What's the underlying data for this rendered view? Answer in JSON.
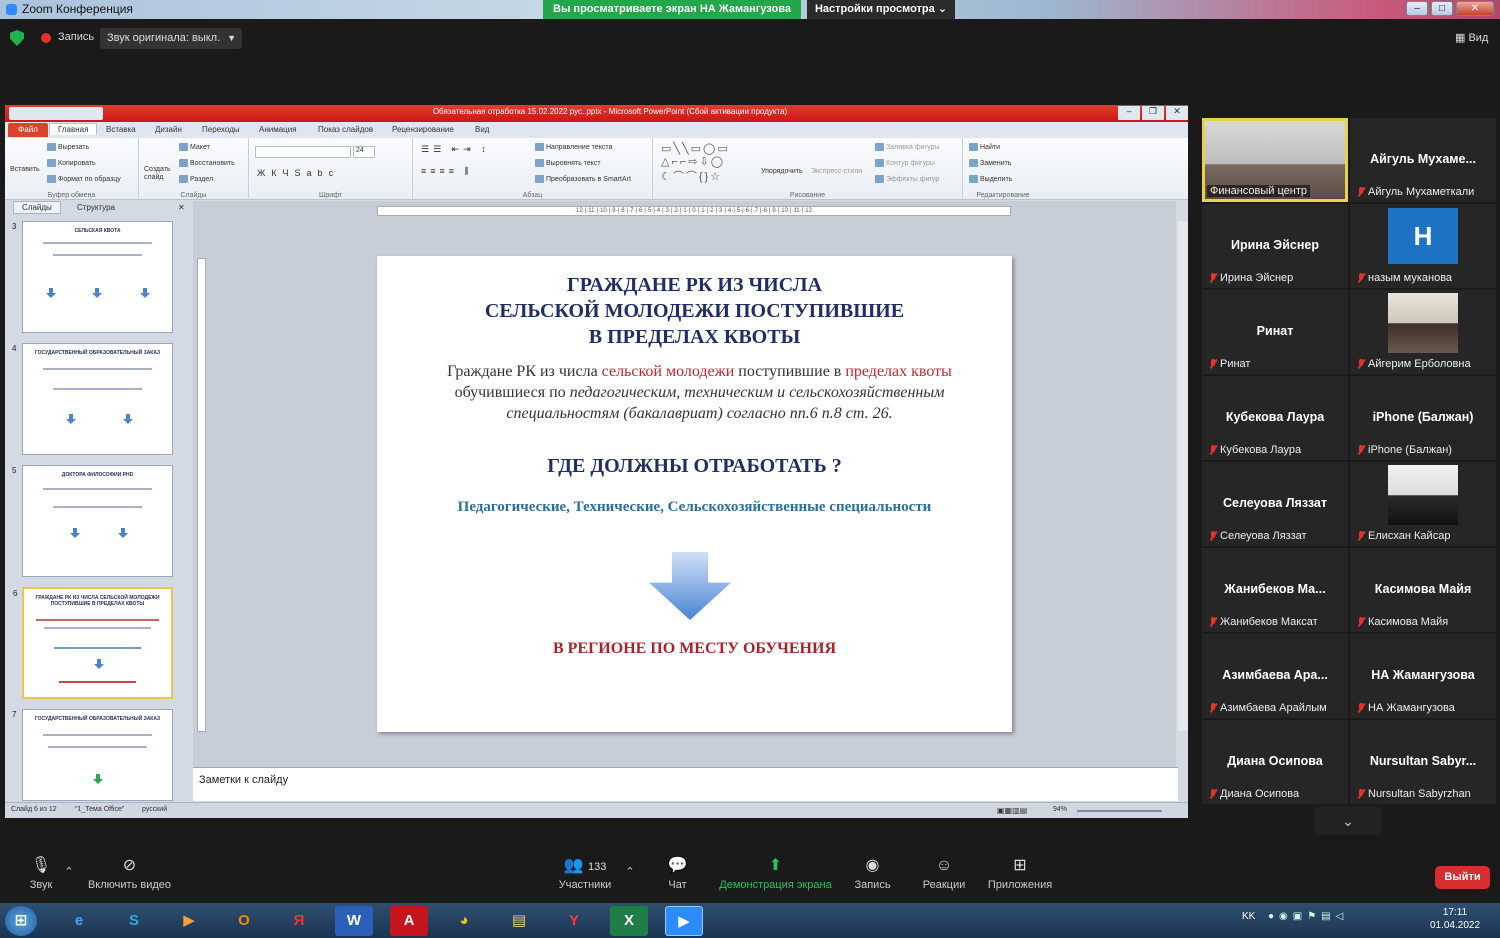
{
  "window": {
    "title": "Zoom Конференция"
  },
  "banner": {
    "viewing": "Вы просматриваете экран НА Жамангузова",
    "view_settings": "Настройки просмотра"
  },
  "topbar": {
    "record": "Запись",
    "original_sound": "Звук оригинала: выкл.",
    "view": "Вид"
  },
  "ppt": {
    "title": "Обязательная отработка 15.02.2022 рус..pptx - Microsoft PowerPoint (Сбой активации продукта)",
    "tabs": [
      "Файл",
      "Главная",
      "Вставка",
      "Дизайн",
      "Переходы",
      "Анимация",
      "Показ слайдов",
      "Рецензирование",
      "Вид"
    ],
    "ribbon": {
      "clipboard": {
        "paste": "Вставить",
        "cut": "Вырезать",
        "copy": "Копировать",
        "format": "Формат по образцу",
        "label": "Буфер обмена"
      },
      "slides": {
        "new": "Создать слайд",
        "layout": "Макет",
        "reset": "Восстановить",
        "section": "Раздел",
        "label": "Слайды"
      },
      "font": {
        "label": "Шрифт",
        "size": "24"
      },
      "paragraph": {
        "dir": "Направление текста",
        "align": "Выровнять текст",
        "smartart": "Преобразовать в SmartArt",
        "label": "Абзац"
      },
      "drawing": {
        "arrange": "Упорядочить",
        "styles": "Экспресс-стили",
        "fill": "Заливка фигуры",
        "outline": "Контур фигуры",
        "effects": "Эффекты фигур",
        "label": "Рисование"
      },
      "editing": {
        "find": "Найти",
        "replace": "Заменить",
        "select": "Выделить",
        "label": "Редактирование"
      }
    },
    "panel_tabs": [
      "Слайды",
      "Структура"
    ],
    "thumbs": [
      {
        "num": "3",
        "title": "СЕЛЬСКАЯ КВОТА"
      },
      {
        "num": "4",
        "title": "ГОСУДАРСТВЕННЫЙ ОБРАЗОВАТЕЛЬНЫЙ ЗАКАЗ"
      },
      {
        "num": "5",
        "title": "ДОКТОРА ФИЛОСОФИИ PHD"
      },
      {
        "num": "6",
        "title": "ГРАЖДАНЕ РК ИЗ ЧИСЛА СЕЛЬСКОЙ МОЛОДЕЖИ ПОСТУПИВШИЕ В ПРЕДЕЛАХ КВОТЫ"
      },
      {
        "num": "7",
        "title": "ГОСУДАРСТВЕННЫЙ ОБРАЗОВАТЕЛЬНЫЙ ЗАКАЗ"
      }
    ],
    "ruler": "·12·|·11·|·10·|·9·|·8·|·7·|·6·|·5·|·4·|·3·|·2·|·1·|·0·|·1·|·2·|·3·|·4·|·5·|·6·|·7·|·8·|·9·|·10·|·11·|·12·",
    "slide": {
      "heading_l1": "ГРАЖДАНЕ РК ИЗ ЧИСЛА",
      "heading_l2": "СЕЛЬСКОЙ МОЛОДЕЖИ ПОСТУПИВШИЕ",
      "heading_l3": "В ПРЕДЕЛАХ КВОТЫ",
      "body_1": "Граждане РК из числа ",
      "body_red1": "сельской молодежи",
      "body_2": " поступившие в ",
      "body_red2": "пределах квоты",
      "body_3": " обучившиеся по ",
      "body_it": "педагогическим, техническим и сельскохозяйственным специальностям (бакалавриат) согласно пп.6 п.8 ст. 26.",
      "question": "ГДЕ ДОЛЖНЫ ОТРАБОТАТЬ ?",
      "specs": "Педагогические, Технические, Сельскохозяйственные специальности",
      "answer": "В РЕГИОНЕ ПО МЕСТУ ОБУЧЕНИЯ"
    },
    "notes": "Заметки к слайду",
    "status": {
      "slide": "Слайд 6 из 12",
      "theme": "\"1_Тема Office\"",
      "lang": "русский",
      "zoom": "94%"
    }
  },
  "participants": [
    {
      "name": "",
      "label": "Финансовый центр",
      "type": "photo"
    },
    {
      "name": "Айгуль Мухаме...",
      "label": "Айгуль Мухаметкали",
      "type": "name"
    },
    {
      "name": "Ирина Эйснер",
      "label": "Ирина Эйснер",
      "type": "name"
    },
    {
      "name": "H",
      "label": "назым муканова",
      "type": "avatar"
    },
    {
      "name": "Ринат",
      "label": "Ринат",
      "type": "name"
    },
    {
      "name": "",
      "label": "Айгерим Ерболовна",
      "type": "photo"
    },
    {
      "name": "Кубекова Лаура",
      "label": "Кубекова Лаура",
      "type": "name"
    },
    {
      "name": "iPhone (Балжан)",
      "label": "iPhone (Балжан)",
      "type": "name"
    },
    {
      "name": "Селеуова Ляззат",
      "label": "Селеуова Ляззат",
      "type": "name"
    },
    {
      "name": "",
      "label": "Елисхан Кайсар",
      "type": "photo"
    },
    {
      "name": "Жанибеков Ма...",
      "label": "Жанибеков Максат",
      "type": "name"
    },
    {
      "name": "Касимова Майя",
      "label": "Касимова Майя",
      "type": "name"
    },
    {
      "name": "Азимбаева Ара...",
      "label": "Азимбаева Арайлым",
      "type": "name"
    },
    {
      "name": "НА Жамангузова",
      "label": "НА Жамангузова",
      "type": "name"
    },
    {
      "name": "Диана Осипова",
      "label": "Диана Осипова",
      "type": "name"
    },
    {
      "name": "Nursultan Sabyr...",
      "label": "Nursultan Sabyrzhan",
      "type": "name"
    }
  ],
  "toolbar": {
    "audio": "Звук",
    "video": "Включить видео",
    "participants": "Участники",
    "participants_count": "133",
    "chat": "Чат",
    "share": "Демонстрация экрана",
    "record": "Запись",
    "reactions": "Реакции",
    "apps": "Приложения",
    "leave": "Выйти"
  },
  "taskbar": {
    "lang": "KK",
    "time": "17:11",
    "date": "01.04.2022"
  },
  "colors": {
    "share_green": "#22a74a",
    "leave_red": "#d62e2e",
    "ppt_red": "#c91616",
    "active_speaker": "#e7d34a"
  }
}
